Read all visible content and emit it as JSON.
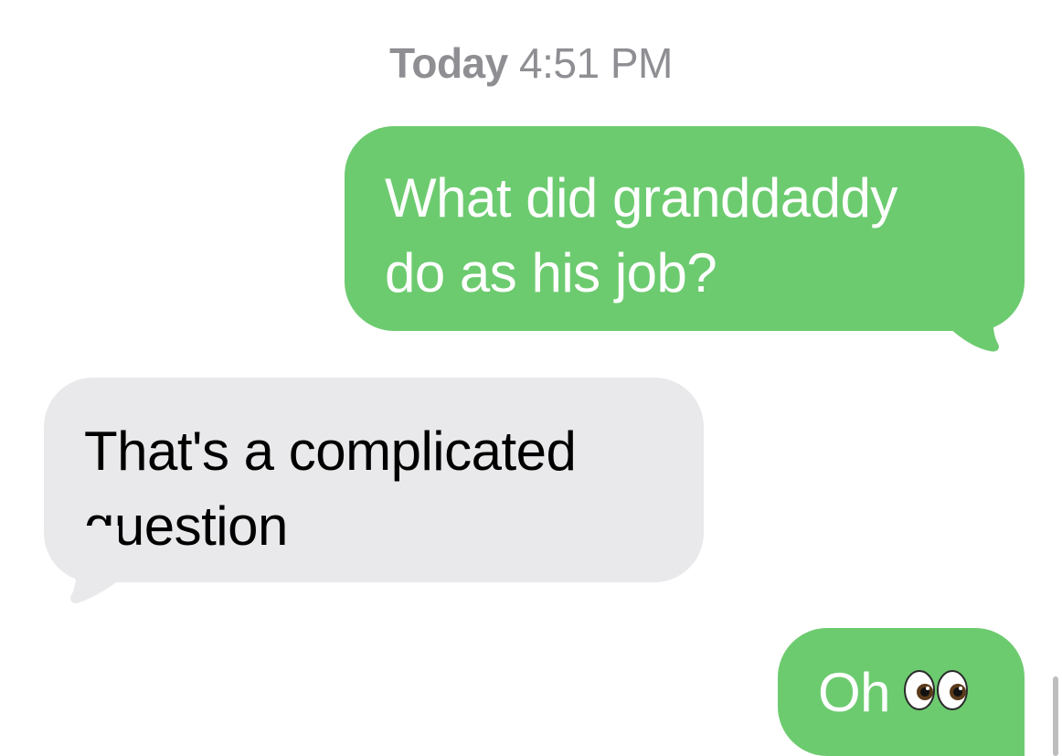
{
  "conversation": {
    "timestamp": {
      "day": "Today",
      "time": "4:51 PM"
    },
    "messages": [
      {
        "direction": "sent",
        "lines": [
          "What did granddaddy",
          "do as his job?"
        ]
      },
      {
        "direction": "received",
        "lines": [
          "That's a complicated",
          "question"
        ]
      },
      {
        "direction": "sent",
        "text": "Oh",
        "emoji": "eyes-emoji"
      }
    ]
  },
  "colors": {
    "sent_bubble": "#6ccb6f",
    "received_bubble": "#e9e9eb",
    "sent_text": "#ffffff",
    "received_text": "#000000",
    "timestamp": "#8e8e93"
  }
}
